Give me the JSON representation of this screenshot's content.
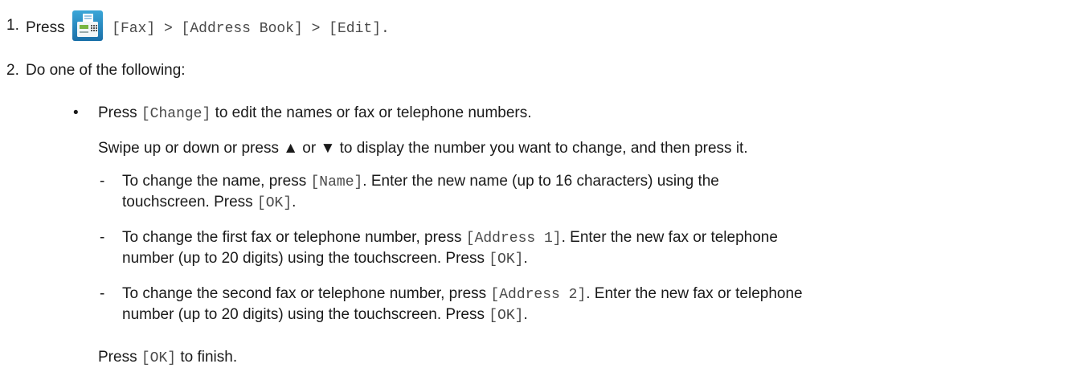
{
  "step1": {
    "number": "1.",
    "press": "Press",
    "icon": "fax-icon",
    "path": "[Fax] > [Address Book] > [Edit]."
  },
  "step2": {
    "number": "2.",
    "text": "Do one of the following:"
  },
  "bullet": {
    "symbol": "•",
    "press": "Press",
    "change": "[Change]",
    "rest": "to edit the names or fax or telephone numbers."
  },
  "swipe": "Swipe up or down or press ▲ or ▼ to display the number you want to change, and then press it.",
  "options": [
    {
      "dash": "-",
      "line1_a": "To change the name, press",
      "line1_code": "[Name]",
      "line1_b": ". Enter the new name (up to 16 characters) using the",
      "line2_a": "touchscreen. Press",
      "line2_code": "[OK]",
      "line2_b": "."
    },
    {
      "dash": "-",
      "line1_a": "To change the first fax or telephone number, press",
      "line1_code": "[Address 1]",
      "line1_b": ". Enter the new fax or telephone",
      "line2_a": "number (up to 20 digits) using the touchscreen. Press",
      "line2_code": "[OK]",
      "line2_b": "."
    },
    {
      "dash": "-",
      "line1_a": "To change the second fax or telephone number, press",
      "line1_code": "[Address 2]",
      "line1_b": ". Enter the new fax or telephone",
      "line2_a": "number (up to 20 digits) using the touchscreen. Press",
      "line2_code": "[OK]",
      "line2_b": "."
    }
  ],
  "finish": {
    "press": "Press",
    "code": "[OK]",
    "rest": "to finish."
  }
}
